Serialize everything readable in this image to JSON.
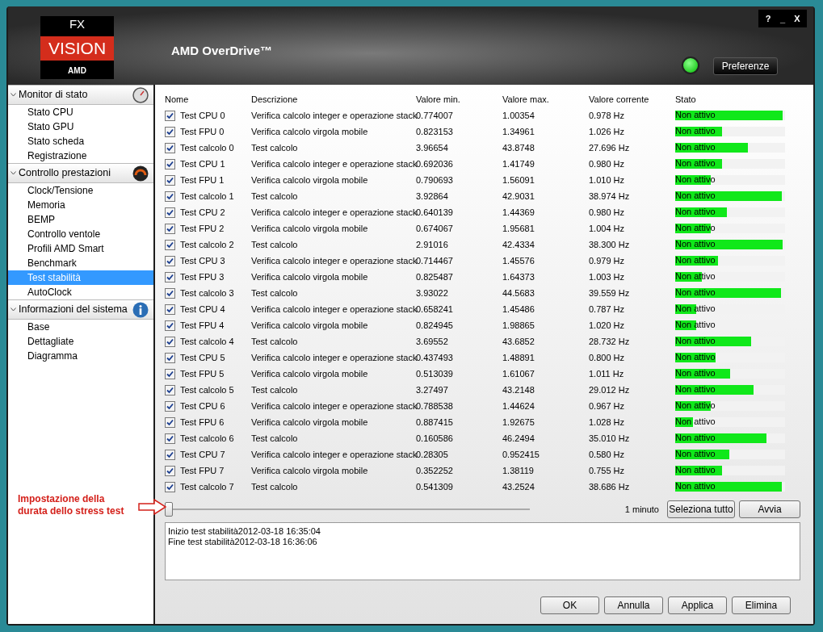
{
  "logo": {
    "top": "FX",
    "middle": "VISION",
    "bottom": "AMD"
  },
  "window": {
    "title": "AMD OverDrive™",
    "controls": [
      "?",
      "_",
      "X"
    ]
  },
  "header": {
    "status_led_on": true,
    "preferences_button": "Preferenze"
  },
  "sidebar": {
    "sections": [
      {
        "label": "Monitor di stato",
        "expanded": true,
        "items": [
          {
            "label": "Stato CPU",
            "selected": false
          },
          {
            "label": "Stato GPU",
            "selected": false
          },
          {
            "label": "Stato scheda",
            "selected": false
          },
          {
            "label": "Registrazione",
            "selected": false
          }
        ]
      },
      {
        "label": "Controllo prestazioni",
        "expanded": true,
        "items": [
          {
            "label": "Clock/Tensione",
            "selected": false
          },
          {
            "label": "Memoria",
            "selected": false
          },
          {
            "label": "BEMP",
            "selected": false
          },
          {
            "label": "Controllo ventole",
            "selected": false
          },
          {
            "label": "Profili AMD Smart",
            "selected": false
          },
          {
            "label": "Benchmark",
            "selected": false
          },
          {
            "label": "Test stabilità",
            "selected": true
          },
          {
            "label": "AutoClock",
            "selected": false
          }
        ]
      },
      {
        "label": "Informazioni del sistema",
        "expanded": true,
        "items": [
          {
            "label": "Base",
            "selected": false
          },
          {
            "label": "Dettagliate",
            "selected": false
          },
          {
            "label": "Diagramma",
            "selected": false
          }
        ]
      }
    ]
  },
  "table": {
    "columns": [
      "Nome",
      "Descrizione",
      "Valore min.",
      "Valore max.",
      "Valore corrente",
      "Stato"
    ],
    "rows": [
      {
        "checked": true,
        "name": "Test CPU 0",
        "description": "Verifica calcolo integer e operazione stack",
        "min": "0.774007",
        "max": "1.00354",
        "current": "0.978 Hz",
        "status": "Non attivo",
        "level": 0.98
      },
      {
        "checked": true,
        "name": "Test FPU 0",
        "description": "Verifica calcolo virgola mobile",
        "min": "0.823153",
        "max": "1.34961",
        "current": "1.026 Hz",
        "status": "Non attivo",
        "level": 0.43
      },
      {
        "checked": true,
        "name": "Test calcolo 0",
        "description": "Test calcolo",
        "min": "3.96654",
        "max": "43.8748",
        "current": "27.696 Hz",
        "status": "Non attivo",
        "level": 0.66
      },
      {
        "checked": true,
        "name": "Test CPU 1",
        "description": "Verifica calcolo integer e operazione stack",
        "min": "0.692036",
        "max": "1.41749",
        "current": "0.980 Hz",
        "status": "Non attivo",
        "level": 0.43
      },
      {
        "checked": true,
        "name": "Test FPU 1",
        "description": "Verifica calcolo virgola mobile",
        "min": "0.790693",
        "max": "1.56091",
        "current": "1.010 Hz",
        "status": "Non attivo",
        "level": 0.32
      },
      {
        "checked": true,
        "name": "Test calcolo 1",
        "description": "Test calcolo",
        "min": "3.92864",
        "max": "42.9031",
        "current": "38.974 Hz",
        "status": "Non attivo",
        "level": 0.97
      },
      {
        "checked": true,
        "name": "Test CPU 2",
        "description": "Verifica calcolo integer e operazione stack",
        "min": "0.640139",
        "max": "1.44369",
        "current": "0.980 Hz",
        "status": "Non attivo",
        "level": 0.47
      },
      {
        "checked": true,
        "name": "Test FPU 2",
        "description": "Verifica calcolo virgola mobile",
        "min": "0.674067",
        "max": "1.95681",
        "current": "1.004 Hz",
        "status": "Non attivo",
        "level": 0.32
      },
      {
        "checked": true,
        "name": "Test calcolo 2",
        "description": "Test calcolo",
        "min": "2.91016",
        "max": "42.4334",
        "current": "38.300 Hz",
        "status": "Non attivo",
        "level": 0.98
      },
      {
        "checked": true,
        "name": "Test CPU 3",
        "description": "Verifica calcolo integer e operazione stack",
        "min": "0.714467",
        "max": "1.45576",
        "current": "0.979 Hz",
        "status": "Non attivo",
        "level": 0.39
      },
      {
        "checked": true,
        "name": "Test FPU 3",
        "description": "Verifica calcolo virgola mobile",
        "min": "0.825487",
        "max": "1.64373",
        "current": "1.003 Hz",
        "status": "Non attivo",
        "level": 0.24
      },
      {
        "checked": true,
        "name": "Test calcolo 3",
        "description": "Test calcolo",
        "min": "3.93022",
        "max": "44.5683",
        "current": "39.559 Hz",
        "status": "Non attivo",
        "level": 0.96
      },
      {
        "checked": true,
        "name": "Test CPU 4",
        "description": "Verifica calcolo integer e operazione stack",
        "min": "0.658241",
        "max": "1.45486",
        "current": "0.787 Hz",
        "status": "Non attivo",
        "level": 0.19
      },
      {
        "checked": true,
        "name": "Test FPU 4",
        "description": "Verifica calcolo virgola mobile",
        "min": "0.824945",
        "max": "1.98865",
        "current": "1.020 Hz",
        "status": "Non attivo",
        "level": 0.19
      },
      {
        "checked": true,
        "name": "Test calcolo 4",
        "description": "Test calcolo",
        "min": "3.69552",
        "max": "43.6852",
        "current": "28.732 Hz",
        "status": "Non attivo",
        "level": 0.69
      },
      {
        "checked": true,
        "name": "Test CPU 5",
        "description": "Verifica calcolo integer e operazione stack",
        "min": "0.437493",
        "max": "1.48891",
        "current": "0.800 Hz",
        "status": "Non attivo",
        "level": 0.37
      },
      {
        "checked": true,
        "name": "Test FPU 5",
        "description": "Verifica calcolo virgola mobile",
        "min": "0.513039",
        "max": "1.61067",
        "current": "1.011 Hz",
        "status": "Non attivo",
        "level": 0.5
      },
      {
        "checked": true,
        "name": "Test calcolo 5",
        "description": "Test calcolo",
        "min": "3.27497",
        "max": "43.2148",
        "current": "29.012 Hz",
        "status": "Non attivo",
        "level": 0.71
      },
      {
        "checked": true,
        "name": "Test CPU 6",
        "description": "Verifica calcolo integer e operazione stack",
        "min": "0.788538",
        "max": "1.44624",
        "current": "0.967 Hz",
        "status": "Non attivo",
        "level": 0.32
      },
      {
        "checked": true,
        "name": "Test FPU 6",
        "description": "Verifica calcolo virgola mobile",
        "min": "0.887415",
        "max": "1.92675",
        "current": "1.028 Hz",
        "status": "Non attivo",
        "level": 0.16
      },
      {
        "checked": true,
        "name": "Test calcolo 6",
        "description": "Test calcolo",
        "min": "0.160586",
        "max": "46.2494",
        "current": "35.010 Hz",
        "status": "Non attivo",
        "level": 0.83
      },
      {
        "checked": true,
        "name": "Test CPU 7",
        "description": "Verifica calcolo integer e operazione stack",
        "min": "0.28305",
        "max": "0.952415",
        "current": "0.580 Hz",
        "status": "Non attivo",
        "level": 0.49
      },
      {
        "checked": true,
        "name": "Test FPU 7",
        "description": "Verifica calcolo virgola mobile",
        "min": "0.352252",
        "max": "1.38119",
        "current": "0.755 Hz",
        "status": "Non attivo",
        "level": 0.43
      },
      {
        "checked": true,
        "name": "Test calcolo 7",
        "description": "Test calcolo",
        "min": "0.541309",
        "max": "43.2524",
        "current": "38.686 Hz",
        "status": "Non attivo",
        "level": 0.97
      }
    ]
  },
  "duration": {
    "level": 0,
    "reading": "1 minuto"
  },
  "actions": [
    "Seleziona tutto",
    "Avvia"
  ],
  "log": [
    "Inizio test stabilità2012-03-18 16:35:04",
    "Fine test stabilità2012-03-18 16:36:06"
  ],
  "footer_buttons": [
    "OK",
    "Annulla",
    "Applica",
    "Elimina"
  ],
  "annotation": [
    "Impostazione della",
    "durata dello stress test"
  ]
}
